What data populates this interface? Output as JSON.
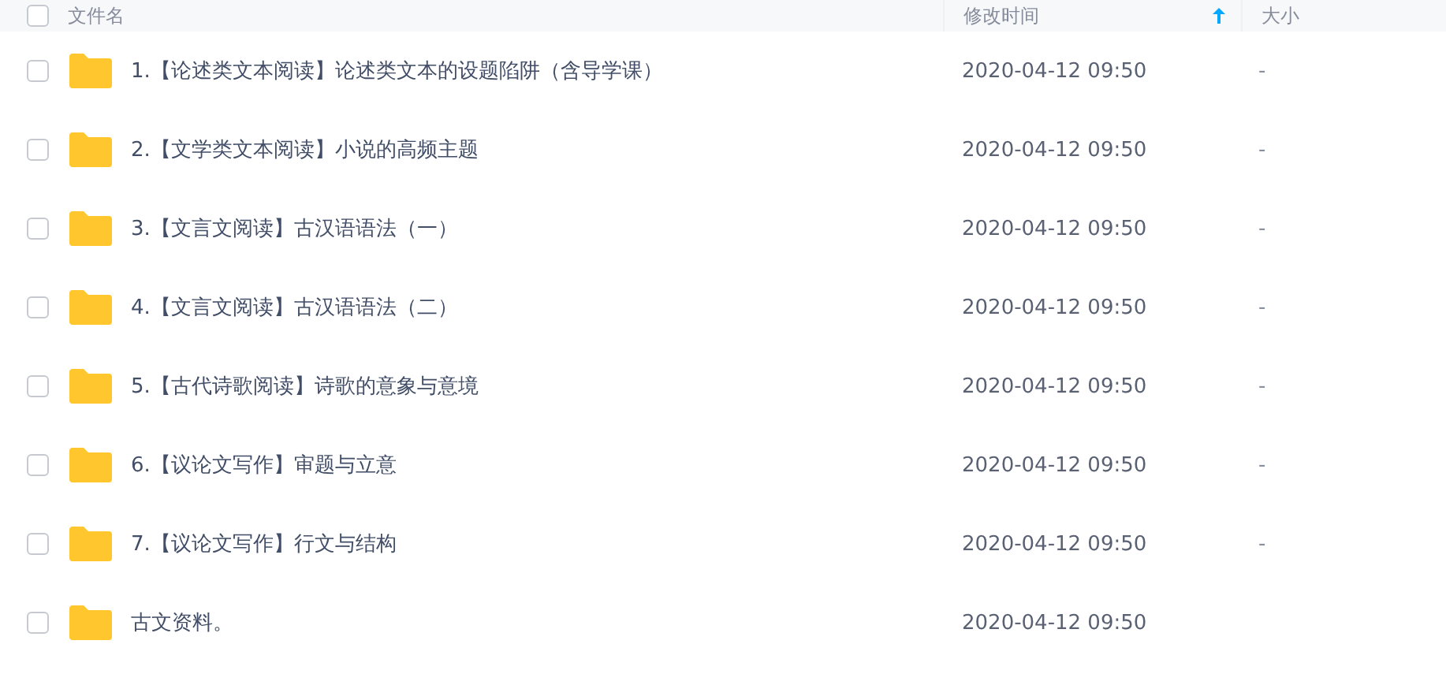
{
  "header": {
    "columns": [
      {
        "label": "文件名"
      },
      {
        "label": "修改时间",
        "sorted": true
      },
      {
        "label": "大小"
      }
    ],
    "checked": false
  },
  "rows": [
    {
      "name": "1.【论述类文本阅读】论述类文本的设题陷阱（含导学课）",
      "modified": "2020-04-12 09:50",
      "size": "-",
      "checked": false
    },
    {
      "name": "2.【文学类文本阅读】小说的高频主题",
      "modified": "2020-04-12 09:50",
      "size": "-",
      "checked": false
    },
    {
      "name": "3.【文言文阅读】古汉语语法（一）",
      "modified": "2020-04-12 09:50",
      "size": "-",
      "checked": false
    },
    {
      "name": "4.【文言文阅读】古汉语语法（二）",
      "modified": "2020-04-12 09:50",
      "size": "-",
      "checked": false
    },
    {
      "name": "5.【古代诗歌阅读】诗歌的意象与意境",
      "modified": "2020-04-12 09:50",
      "size": "-",
      "checked": false
    },
    {
      "name": "6.【议论文写作】审题与立意",
      "modified": "2020-04-12 09:50",
      "size": "-",
      "checked": false
    },
    {
      "name": "7.【议论文写作】行文与结构",
      "modified": "2020-04-12 09:50",
      "size": "-",
      "checked": false
    },
    {
      "name": "古文资料。",
      "modified": "2020-04-12 09:50",
      "size": "",
      "checked": false
    }
  ]
}
